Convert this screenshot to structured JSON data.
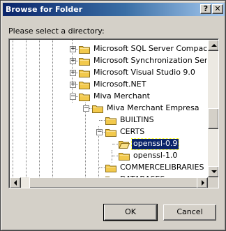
{
  "window": {
    "title": "Browse for Folder",
    "help_label": "?",
    "close_label": "✕"
  },
  "prompt": "Please select a directory:",
  "tree": {
    "items": [
      {
        "label": "Microsoft SQL Server Compact Ed",
        "expander": "+",
        "level": 0
      },
      {
        "label": "Microsoft Synchronization Service",
        "expander": "+",
        "level": 0
      },
      {
        "label": "Microsoft Visual Studio 9.0",
        "expander": "+",
        "level": 0
      },
      {
        "label": "Microsoft.NET",
        "expander": "+",
        "level": 0
      },
      {
        "label": "Miva Merchant",
        "expander": "−",
        "level": 0
      },
      {
        "label": "Miva Merchant Empresa",
        "expander": "−",
        "level": 1
      },
      {
        "label": "BUILTINS",
        "expander": "",
        "level": 2
      },
      {
        "label": "CERTS",
        "expander": "−",
        "level": 2
      },
      {
        "label": "openssl-0.9",
        "expander": "",
        "level": 3,
        "selected": true,
        "open": true
      },
      {
        "label": "openssl-1.0",
        "expander": "",
        "level": 3
      },
      {
        "label": "COMMERCELIBRARIES",
        "expander": "",
        "level": 2
      },
      {
        "label": "DATABASES",
        "expander": "",
        "level": 2
      }
    ]
  },
  "buttons": {
    "ok": "OK",
    "cancel": "Cancel"
  },
  "colors": {
    "title_bar_start": "#0a246a",
    "title_bar_end": "#a6caf0",
    "selection": "#0a246a",
    "folder": "#f2c94c",
    "dialog_bg": "#d4d0c8"
  }
}
